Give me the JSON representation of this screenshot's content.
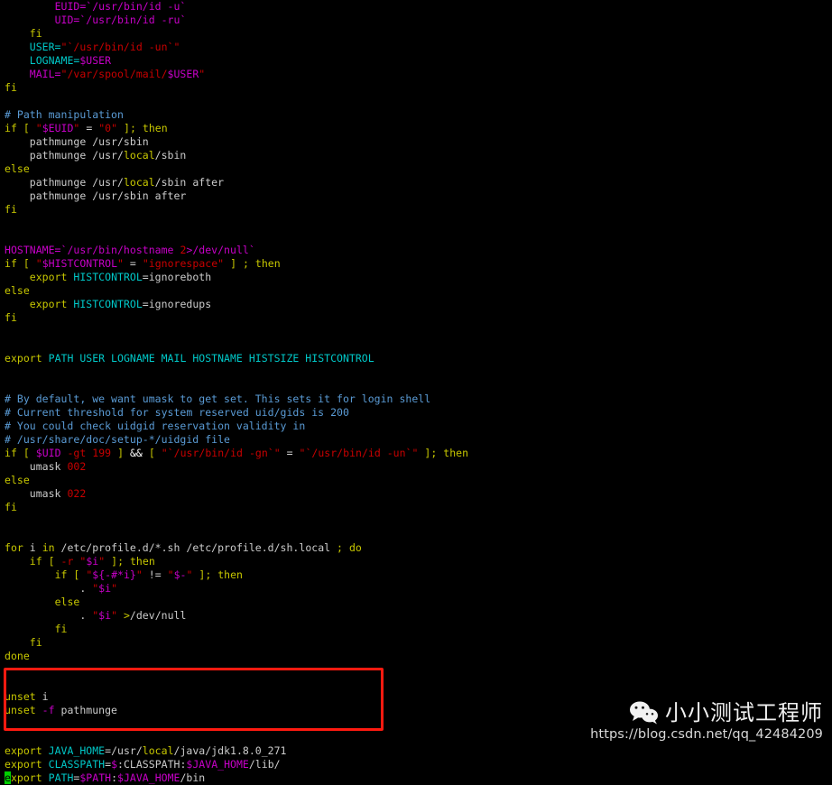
{
  "terminal": {
    "background": "#000000",
    "default_text_color": "#cccccc",
    "colors": {
      "comment": "#5a9bd5",
      "keyword": "#c8c800",
      "builtin_var": "#00c8c8",
      "variable": "#c800c8",
      "string": "#c80000",
      "number": "#c80000",
      "plain": "#cccccc",
      "cursor": "#00d000",
      "highlight_box": "#ff1a10"
    },
    "file_kind": "/etc/profile shell script (vim)",
    "lines": [
      {
        "id": 1,
        "tokens": [
          {
            "t": "plain",
            "v": "        "
          },
          {
            "t": "var",
            "v": "EUID="
          },
          {
            "t": "var",
            "v": "`/usr/bin/id -u`"
          }
        ]
      },
      {
        "id": 2,
        "tokens": [
          {
            "t": "plain",
            "v": "        "
          },
          {
            "t": "var",
            "v": "UID="
          },
          {
            "t": "var",
            "v": "`/usr/bin/id -ru`"
          }
        ]
      },
      {
        "id": 3,
        "tokens": [
          {
            "t": "plain",
            "v": "    "
          },
          {
            "t": "keyword",
            "v": "fi"
          }
        ]
      },
      {
        "id": 4,
        "tokens": [
          {
            "t": "plain",
            "v": "    "
          },
          {
            "t": "builtin",
            "v": "USER="
          },
          {
            "t": "string",
            "v": "\"`/usr/bin/id -un`\""
          }
        ]
      },
      {
        "id": 5,
        "tokens": [
          {
            "t": "plain",
            "v": "    "
          },
          {
            "t": "builtin",
            "v": "LOGNAME="
          },
          {
            "t": "var",
            "v": "$USER"
          }
        ]
      },
      {
        "id": 6,
        "tokens": [
          {
            "t": "plain",
            "v": "    "
          },
          {
            "t": "var",
            "v": "MAIL="
          },
          {
            "t": "string",
            "v": "\"/var/spool/mail/"
          },
          {
            "t": "var",
            "v": "$USER"
          },
          {
            "t": "string",
            "v": "\""
          }
        ]
      },
      {
        "id": 7,
        "tokens": [
          {
            "t": "keyword",
            "v": "fi"
          }
        ]
      },
      {
        "id": 8,
        "tokens": []
      },
      {
        "id": 9,
        "tokens": [
          {
            "t": "comment",
            "v": "# Path manipulation"
          }
        ]
      },
      {
        "id": 10,
        "tokens": [
          {
            "t": "keyword",
            "v": "if"
          },
          {
            "t": "plain",
            "v": " "
          },
          {
            "t": "keyword",
            "v": "["
          },
          {
            "t": "plain",
            "v": " "
          },
          {
            "t": "string",
            "v": "\""
          },
          {
            "t": "var",
            "v": "$EUID"
          },
          {
            "t": "string",
            "v": "\""
          },
          {
            "t": "plain",
            "v": " = "
          },
          {
            "t": "string",
            "v": "\"0\""
          },
          {
            "t": "plain",
            "v": " "
          },
          {
            "t": "keyword",
            "v": "]"
          },
          {
            "t": "keyword",
            "v": ";"
          },
          {
            "t": "plain",
            "v": " "
          },
          {
            "t": "keyword",
            "v": "then"
          }
        ]
      },
      {
        "id": 11,
        "tokens": [
          {
            "t": "plain",
            "v": "    pathmunge /usr/sbin"
          }
        ]
      },
      {
        "id": 12,
        "tokens": [
          {
            "t": "plain",
            "v": "    pathmunge /usr/"
          },
          {
            "t": "keyword",
            "v": "local"
          },
          {
            "t": "plain",
            "v": "/sbin"
          }
        ]
      },
      {
        "id": 13,
        "tokens": [
          {
            "t": "keyword",
            "v": "else"
          }
        ]
      },
      {
        "id": 14,
        "tokens": [
          {
            "t": "plain",
            "v": "    pathmunge /usr/"
          },
          {
            "t": "keyword",
            "v": "local"
          },
          {
            "t": "plain",
            "v": "/sbin after"
          }
        ]
      },
      {
        "id": 15,
        "tokens": [
          {
            "t": "plain",
            "v": "    pathmunge /usr/sbin after"
          }
        ]
      },
      {
        "id": 16,
        "tokens": [
          {
            "t": "keyword",
            "v": "fi"
          }
        ]
      },
      {
        "id": 17,
        "tokens": []
      },
      {
        "id": 18,
        "tokens": []
      },
      {
        "id": 19,
        "tokens": [
          {
            "t": "var",
            "v": "HOSTNAME="
          },
          {
            "t": "var",
            "v": "`/usr/bin/hostname "
          },
          {
            "t": "number",
            "v": "2"
          },
          {
            "t": "var",
            "v": ">/dev/null`"
          }
        ]
      },
      {
        "id": 20,
        "tokens": [
          {
            "t": "keyword",
            "v": "if"
          },
          {
            "t": "plain",
            "v": " "
          },
          {
            "t": "keyword",
            "v": "["
          },
          {
            "t": "plain",
            "v": " "
          },
          {
            "t": "string",
            "v": "\""
          },
          {
            "t": "var",
            "v": "$HISTCONTROL"
          },
          {
            "t": "string",
            "v": "\""
          },
          {
            "t": "plain",
            "v": " = "
          },
          {
            "t": "string",
            "v": "\"ignorespace\""
          },
          {
            "t": "plain",
            "v": " "
          },
          {
            "t": "keyword",
            "v": "]"
          },
          {
            "t": "plain",
            "v": " "
          },
          {
            "t": "keyword",
            "v": ";"
          },
          {
            "t": "plain",
            "v": " "
          },
          {
            "t": "keyword",
            "v": "then"
          }
        ]
      },
      {
        "id": 21,
        "tokens": [
          {
            "t": "plain",
            "v": "    "
          },
          {
            "t": "keyword",
            "v": "export"
          },
          {
            "t": "plain",
            "v": " "
          },
          {
            "t": "builtin",
            "v": "HISTCONTROL"
          },
          {
            "t": "plain",
            "v": "=ignoreboth"
          }
        ]
      },
      {
        "id": 22,
        "tokens": [
          {
            "t": "keyword",
            "v": "else"
          }
        ]
      },
      {
        "id": 23,
        "tokens": [
          {
            "t": "plain",
            "v": "    "
          },
          {
            "t": "keyword",
            "v": "export"
          },
          {
            "t": "plain",
            "v": " "
          },
          {
            "t": "builtin",
            "v": "HISTCONTROL"
          },
          {
            "t": "plain",
            "v": "=ignoredups"
          }
        ]
      },
      {
        "id": 24,
        "tokens": [
          {
            "t": "keyword",
            "v": "fi"
          }
        ]
      },
      {
        "id": 25,
        "tokens": []
      },
      {
        "id": 26,
        "tokens": []
      },
      {
        "id": 27,
        "tokens": [
          {
            "t": "keyword",
            "v": "export"
          },
          {
            "t": "plain",
            "v": " "
          },
          {
            "t": "builtin",
            "v": "PATH USER LOGNAME MAIL HOSTNAME HISTSIZE HISTCONTROL"
          }
        ]
      },
      {
        "id": 28,
        "tokens": []
      },
      {
        "id": 29,
        "tokens": []
      },
      {
        "id": 30,
        "tokens": [
          {
            "t": "comment",
            "v": "# By default, we want umask to get set. This sets it for login shell"
          }
        ]
      },
      {
        "id": 31,
        "tokens": [
          {
            "t": "comment",
            "v": "# Current threshold for system reserved uid/gids is 200"
          }
        ]
      },
      {
        "id": 32,
        "tokens": [
          {
            "t": "comment",
            "v": "# You could check uidgid reservation validity in"
          }
        ]
      },
      {
        "id": 33,
        "tokens": [
          {
            "t": "comment",
            "v": "# /usr/share/doc/setup-*/uidgid file"
          }
        ]
      },
      {
        "id": 34,
        "tokens": [
          {
            "t": "keyword",
            "v": "if"
          },
          {
            "t": "plain",
            "v": " "
          },
          {
            "t": "keyword",
            "v": "["
          },
          {
            "t": "plain",
            "v": " "
          },
          {
            "t": "var",
            "v": "$UID"
          },
          {
            "t": "plain",
            "v": " "
          },
          {
            "t": "string",
            "v": "-gt"
          },
          {
            "t": "plain",
            "v": " "
          },
          {
            "t": "number",
            "v": "199"
          },
          {
            "t": "plain",
            "v": " "
          },
          {
            "t": "keyword",
            "v": "]"
          },
          {
            "t": "plain",
            "v": " "
          },
          {
            "t": "white",
            "v": "&&"
          },
          {
            "t": "plain",
            "v": " "
          },
          {
            "t": "keyword",
            "v": "["
          },
          {
            "t": "plain",
            "v": " "
          },
          {
            "t": "string",
            "v": "\"`/usr/bin/id -gn`\""
          },
          {
            "t": "plain",
            "v": " = "
          },
          {
            "t": "string",
            "v": "\"`/usr/bin/id -un`\""
          },
          {
            "t": "plain",
            "v": " "
          },
          {
            "t": "keyword",
            "v": "]"
          },
          {
            "t": "keyword",
            "v": ";"
          },
          {
            "t": "plain",
            "v": " "
          },
          {
            "t": "keyword",
            "v": "then"
          }
        ]
      },
      {
        "id": 35,
        "tokens": [
          {
            "t": "plain",
            "v": "    umask "
          },
          {
            "t": "number",
            "v": "002"
          }
        ]
      },
      {
        "id": 36,
        "tokens": [
          {
            "t": "keyword",
            "v": "else"
          }
        ]
      },
      {
        "id": 37,
        "tokens": [
          {
            "t": "plain",
            "v": "    umask "
          },
          {
            "t": "number",
            "v": "022"
          }
        ]
      },
      {
        "id": 38,
        "tokens": [
          {
            "t": "keyword",
            "v": "fi"
          }
        ]
      },
      {
        "id": 39,
        "tokens": []
      },
      {
        "id": 40,
        "tokens": []
      },
      {
        "id": 41,
        "tokens": [
          {
            "t": "keyword",
            "v": "for"
          },
          {
            "t": "plain",
            "v": " i "
          },
          {
            "t": "keyword",
            "v": "in"
          },
          {
            "t": "plain",
            "v": " /etc/profile.d/*.sh /etc/profile.d/sh.local "
          },
          {
            "t": "keyword",
            "v": ";"
          },
          {
            "t": "plain",
            "v": " "
          },
          {
            "t": "keyword",
            "v": "do"
          }
        ]
      },
      {
        "id": 42,
        "tokens": [
          {
            "t": "plain",
            "v": "    "
          },
          {
            "t": "keyword",
            "v": "if"
          },
          {
            "t": "plain",
            "v": " "
          },
          {
            "t": "keyword",
            "v": "["
          },
          {
            "t": "plain",
            "v": " "
          },
          {
            "t": "string",
            "v": "-r"
          },
          {
            "t": "plain",
            "v": " "
          },
          {
            "t": "string",
            "v": "\""
          },
          {
            "t": "var",
            "v": "$i"
          },
          {
            "t": "string",
            "v": "\""
          },
          {
            "t": "plain",
            "v": " "
          },
          {
            "t": "keyword",
            "v": "]"
          },
          {
            "t": "keyword",
            "v": ";"
          },
          {
            "t": "plain",
            "v": " "
          },
          {
            "t": "keyword",
            "v": "then"
          }
        ]
      },
      {
        "id": 43,
        "tokens": [
          {
            "t": "plain",
            "v": "        "
          },
          {
            "t": "keyword",
            "v": "if"
          },
          {
            "t": "plain",
            "v": " "
          },
          {
            "t": "keyword",
            "v": "["
          },
          {
            "t": "plain",
            "v": " "
          },
          {
            "t": "string",
            "v": "\""
          },
          {
            "t": "var",
            "v": "${-#*i}"
          },
          {
            "t": "string",
            "v": "\""
          },
          {
            "t": "plain",
            "v": " != "
          },
          {
            "t": "string",
            "v": "\""
          },
          {
            "t": "var",
            "v": "$-"
          },
          {
            "t": "string",
            "v": "\""
          },
          {
            "t": "plain",
            "v": " "
          },
          {
            "t": "keyword",
            "v": "]"
          },
          {
            "t": "keyword",
            "v": ";"
          },
          {
            "t": "plain",
            "v": " "
          },
          {
            "t": "keyword",
            "v": "then"
          }
        ]
      },
      {
        "id": 44,
        "tokens": [
          {
            "t": "plain",
            "v": "            . "
          },
          {
            "t": "string",
            "v": "\""
          },
          {
            "t": "var",
            "v": "$i"
          },
          {
            "t": "string",
            "v": "\""
          }
        ]
      },
      {
        "id": 45,
        "tokens": [
          {
            "t": "plain",
            "v": "        "
          },
          {
            "t": "keyword",
            "v": "else"
          }
        ]
      },
      {
        "id": 46,
        "tokens": [
          {
            "t": "plain",
            "v": "            . "
          },
          {
            "t": "string",
            "v": "\""
          },
          {
            "t": "var",
            "v": "$i"
          },
          {
            "t": "string",
            "v": "\""
          },
          {
            "t": "plain",
            "v": " "
          },
          {
            "t": "keyword",
            "v": ">"
          },
          {
            "t": "plain",
            "v": "/dev/null"
          }
        ]
      },
      {
        "id": 47,
        "tokens": [
          {
            "t": "plain",
            "v": "        "
          },
          {
            "t": "keyword",
            "v": "fi"
          }
        ]
      },
      {
        "id": 48,
        "tokens": [
          {
            "t": "plain",
            "v": "    "
          },
          {
            "t": "keyword",
            "v": "fi"
          }
        ]
      },
      {
        "id": 49,
        "tokens": [
          {
            "t": "keyword",
            "v": "done"
          }
        ]
      },
      {
        "id": 50,
        "tokens": []
      },
      {
        "id": 51,
        "tokens": []
      },
      {
        "id": 52,
        "tokens": [
          {
            "t": "keyword",
            "v": "unset"
          },
          {
            "t": "plain",
            "v": " i"
          }
        ]
      },
      {
        "id": 53,
        "tokens": [
          {
            "t": "keyword",
            "v": "unset"
          },
          {
            "t": "plain",
            "v": " "
          },
          {
            "t": "var",
            "v": "-f"
          },
          {
            "t": "plain",
            "v": " pathmunge"
          }
        ]
      },
      {
        "id": 54,
        "tokens": []
      },
      {
        "id": 55,
        "tokens": []
      },
      {
        "id": 56,
        "tokens": [
          {
            "t": "keyword",
            "v": "export"
          },
          {
            "t": "plain",
            "v": " "
          },
          {
            "t": "builtin",
            "v": "JAVA_HOME"
          },
          {
            "t": "plain",
            "v": "=/usr/"
          },
          {
            "t": "keyword",
            "v": "local"
          },
          {
            "t": "plain",
            "v": "/java/jdk1.8.0_271"
          }
        ]
      },
      {
        "id": 57,
        "tokens": [
          {
            "t": "keyword",
            "v": "export"
          },
          {
            "t": "plain",
            "v": " "
          },
          {
            "t": "builtin",
            "v": "CLASSPATH"
          },
          {
            "t": "plain",
            "v": "="
          },
          {
            "t": "var",
            "v": "$"
          },
          {
            "t": "plain",
            "v": ":CLASSPATH:"
          },
          {
            "t": "var",
            "v": "$JAVA_HOME"
          },
          {
            "t": "plain",
            "v": "/lib/"
          }
        ]
      },
      {
        "id": 58,
        "cursor_col": 0,
        "tokens": [
          {
            "t": "keyword",
            "v": "export"
          },
          {
            "t": "plain",
            "v": " "
          },
          {
            "t": "builtin",
            "v": "PATH"
          },
          {
            "t": "plain",
            "v": "="
          },
          {
            "t": "var",
            "v": "$PATH"
          },
          {
            "t": "plain",
            "v": ":"
          },
          {
            "t": "var",
            "v": "$JAVA_HOME"
          },
          {
            "t": "plain",
            "v": "/bin"
          }
        ]
      }
    ]
  },
  "highlight": {
    "label": "java-env-highlight-box",
    "color": "#ff1a10",
    "covers_lines": [
      56,
      57,
      58
    ]
  },
  "watermark": {
    "icon": "wechat-icon",
    "title": "小小测试工程师",
    "url": "https://blog.csdn.net/qq_42484209"
  }
}
